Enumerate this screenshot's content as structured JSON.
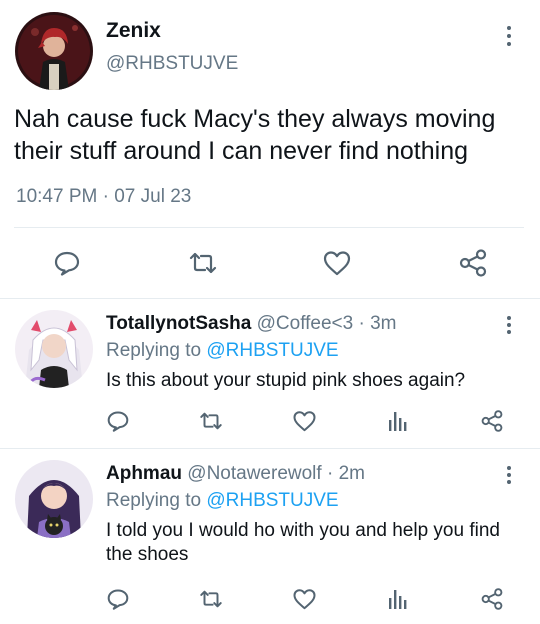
{
  "main_tweet": {
    "author_name": "Zenix",
    "author_handle": "@RHBSTUJVE",
    "text": "Nah cause fuck Macy's they always moving their stuff around I can never find nothing",
    "timestamp": "10:47 PM · 07 Jul 23",
    "actions": [
      "reply-icon",
      "retweet-icon",
      "like-icon",
      "share-icon"
    ]
  },
  "replies": [
    {
      "author_name": "TotallynotSasha",
      "author_handle": "@Coffee<3",
      "separator": "·",
      "time": "3m",
      "replying_label": "Replying to",
      "replying_to": "@RHBSTUJVE",
      "text": "Is this about your stupid pink shoes again?",
      "actions": [
        "reply-icon",
        "retweet-icon",
        "like-icon",
        "analytics-icon",
        "share-icon"
      ]
    },
    {
      "author_name": "Aphmau",
      "author_handle": "@Notawerewolf",
      "separator": "·",
      "time": "2m",
      "replying_label": "Replying to",
      "replying_to": "@RHBSTUJVE",
      "text": "I told you I would ho with you and help you find the shoes",
      "actions": [
        "reply-icon",
        "retweet-icon",
        "like-icon",
        "analytics-icon",
        "share-icon"
      ]
    }
  ],
  "colors": {
    "text": "#0f1419",
    "secondary": "#657786",
    "link": "#1da1f2",
    "icon": "#536471",
    "divider": "#e6ecf0"
  }
}
